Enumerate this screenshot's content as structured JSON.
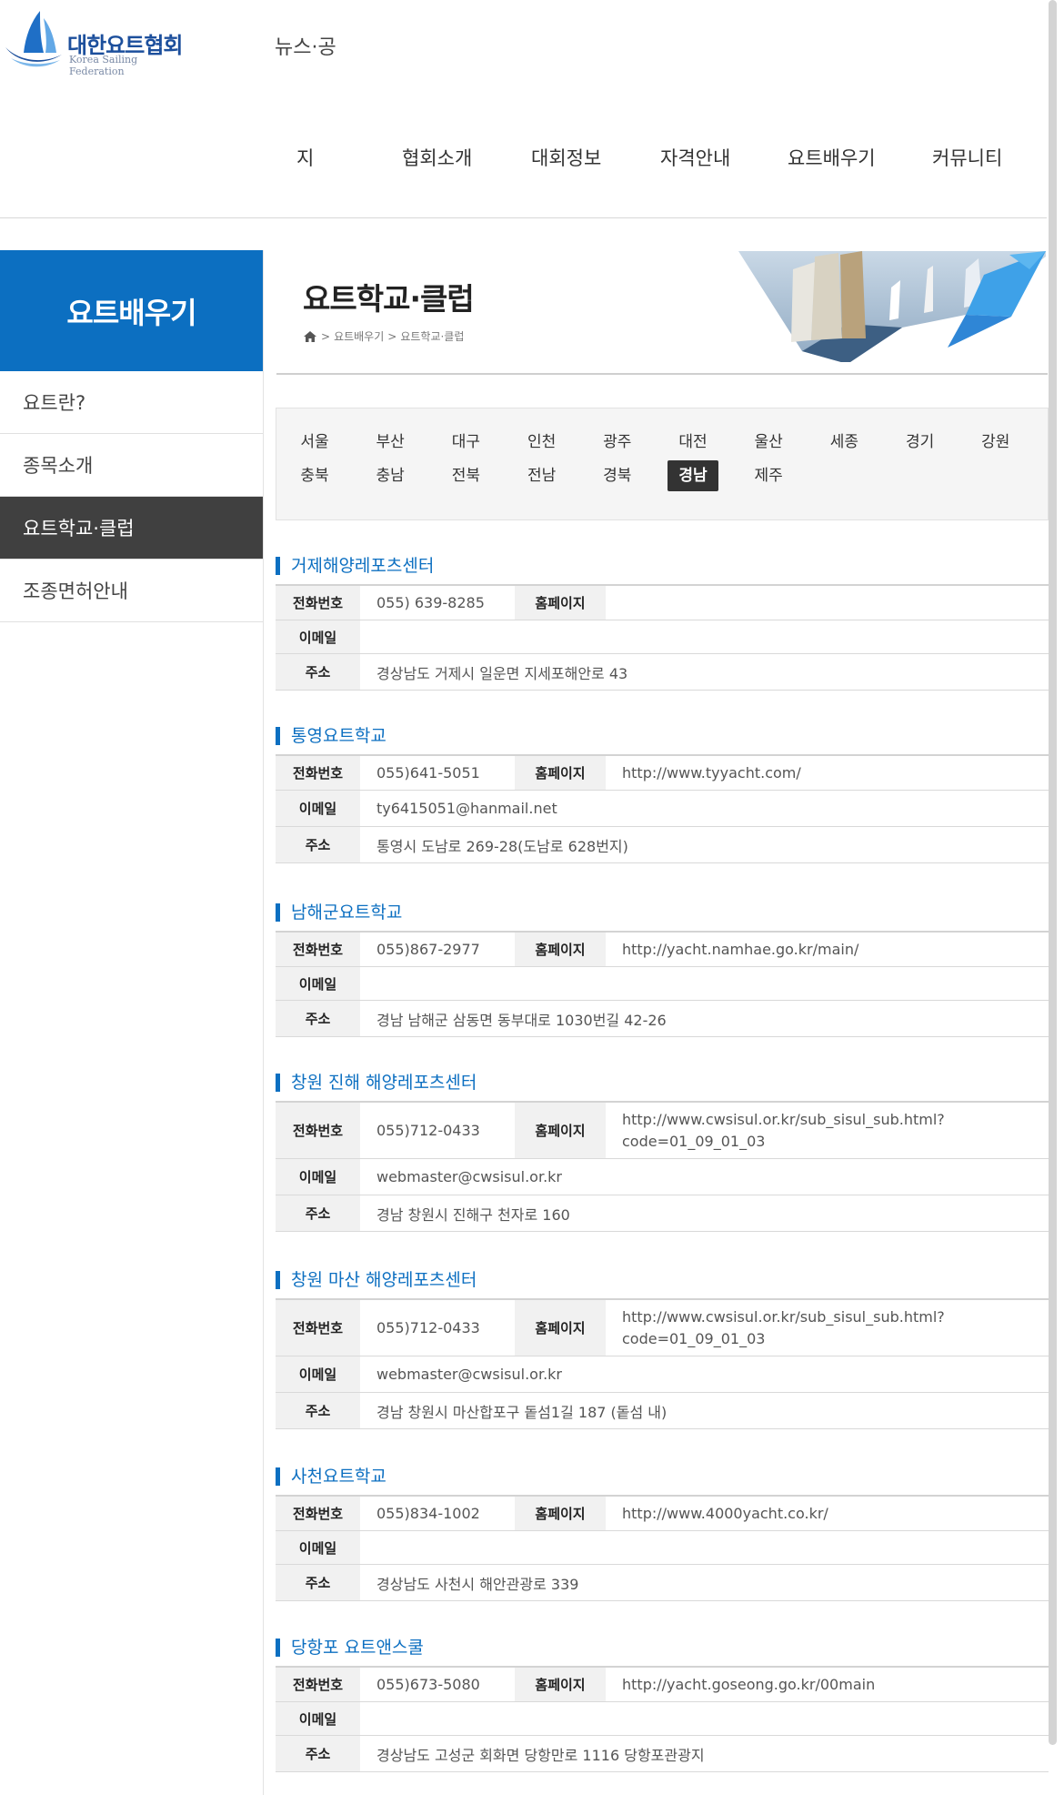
{
  "header": {
    "logo_korean": "대한요트협회",
    "logo_english": "Korea Sailing Federation",
    "top_text": "뉴스·공",
    "nav": [
      "지",
      "협회소개",
      "대회정보",
      "자격안내",
      "요트배우기",
      "커뮤니티"
    ]
  },
  "sidebar": {
    "title": "요트배우기",
    "items": [
      {
        "label": "요트란?"
      },
      {
        "label": "종목소개"
      },
      {
        "label": "요트학교·클럽"
      },
      {
        "label": "조종면허안내"
      }
    ],
    "active_index": 2
  },
  "page": {
    "title": "요트학교·클럽",
    "breadcrumb": [
      ">",
      "요트배우기",
      ">",
      "요트학교·클럽"
    ]
  },
  "regions": [
    "서울",
    "부산",
    "대구",
    "인천",
    "광주",
    "대전",
    "울산",
    "세종",
    "경기",
    "강원",
    "충북",
    "충남",
    "전북",
    "전남",
    "경북",
    "경남",
    "제주"
  ],
  "active_region": "경남",
  "labels": {
    "phone": "전화번호",
    "homepage": "홈페이지",
    "email": "이메일",
    "address": "주소"
  },
  "clubs": [
    {
      "name": "거제해양레포츠센터",
      "phone": "055) 639-8285",
      "homepage": "",
      "email": "",
      "address": "경상남도 거제시 일운면 지세포해안로 43"
    },
    {
      "name": "통영요트학교",
      "phone": "055)641-5051",
      "homepage": "http://www.tyyacht.com/",
      "email": "ty6415051@hanmail.net",
      "address": "통영시 도남로 269-28(도남로 628번지)"
    },
    {
      "name": "남해군요트학교",
      "phone": "055)867-2977",
      "homepage": "http://yacht.namhae.go.kr/main/",
      "email": "",
      "address": "경남 남해군 삼동면 동부대로 1030번길 42-26"
    },
    {
      "name": "창원 진해 해양레포츠센터",
      "phone": "055)712-0433",
      "homepage": "http://www.cwsisul.or.kr/sub_sisul_sub.html?code=01_09_01_03",
      "email": "webmaster@cwsisul.or.kr",
      "address": "경남 창원시 진해구 천자로 160"
    },
    {
      "name": "창원 마산 해양레포츠센터",
      "phone": "055)712-0433",
      "homepage": "http://www.cwsisul.or.kr/sub_sisul_sub.html?code=01_09_01_03",
      "email": "webmaster@cwsisul.or.kr",
      "address": "경남 창원시 마산합포구 돝섬1길 187 (돝섬 내)"
    },
    {
      "name": "사천요트학교",
      "phone": "055)834-1002",
      "homepage": "http://www.4000yacht.co.kr/",
      "email": "",
      "address": "경상남도 사천시 해안관광로 339"
    },
    {
      "name": "당항포 요트앤스쿨",
      "phone": "055)673-5080",
      "homepage": "http://yacht.goseong.go.kr/00main",
      "email": "",
      "address": "경상남도 고성군 회화면 당항만로 1116 당항포관광지"
    }
  ],
  "colors": {
    "accent": "#0c6fc1",
    "active_dark": "#404040"
  },
  "icons": {
    "breadcrumb_home": "home-icon"
  }
}
